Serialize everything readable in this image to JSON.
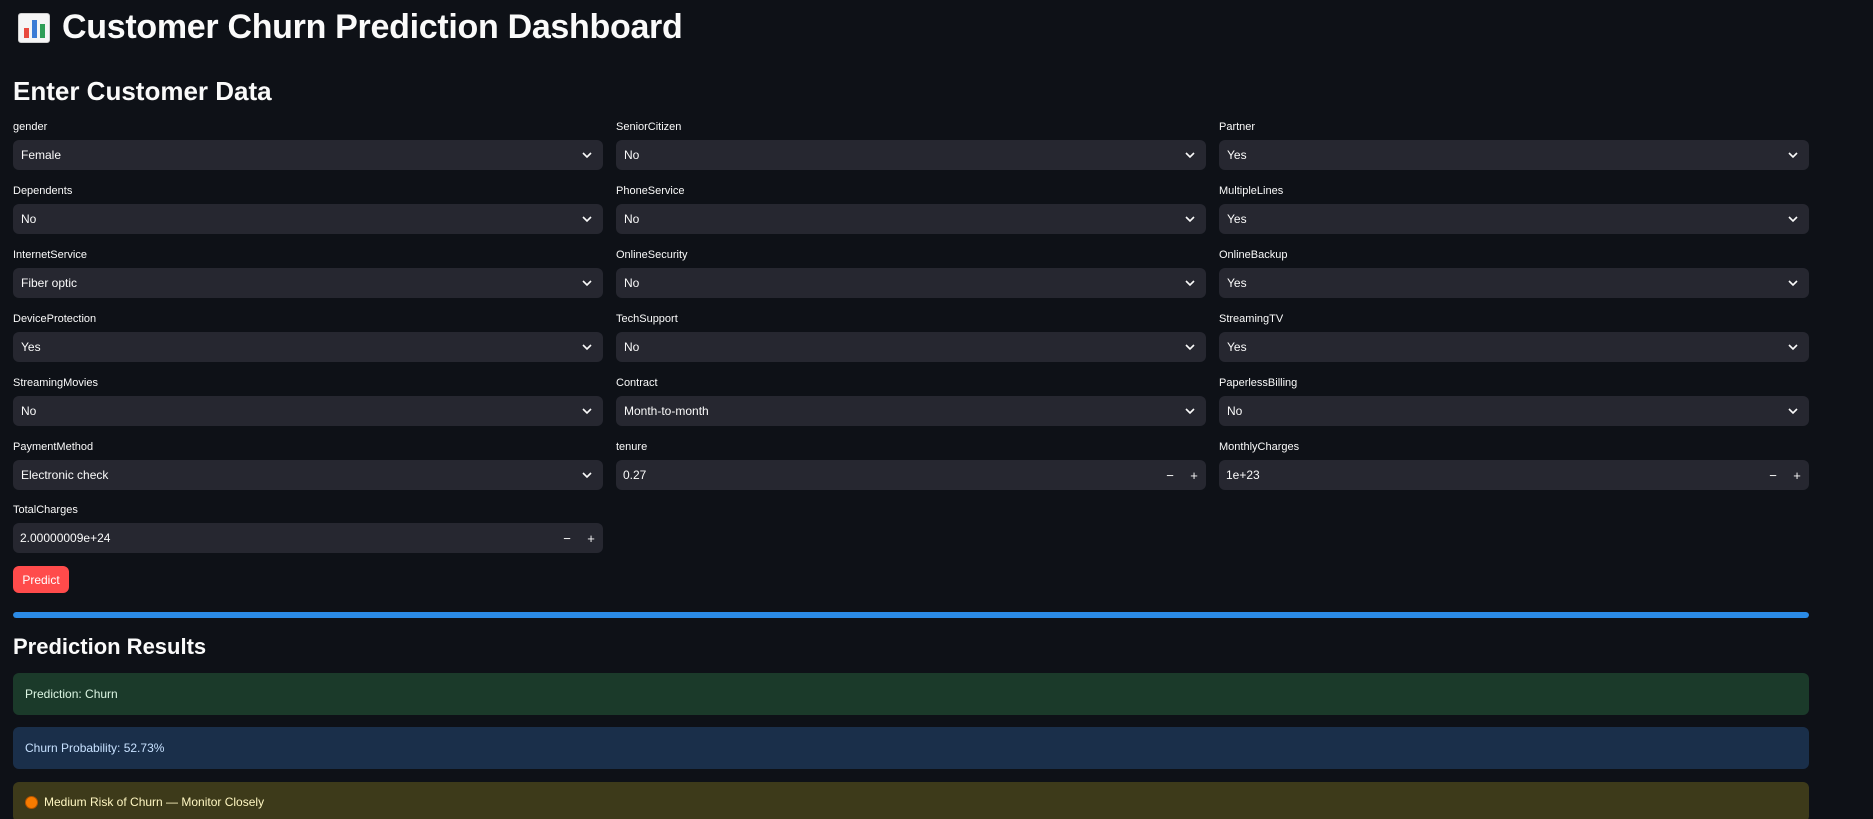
{
  "header": {
    "title": "Customer Churn Prediction Dashboard",
    "icon": "bar-chart-icon"
  },
  "form": {
    "section_title": "Enter Customer Data",
    "fields": [
      {
        "label": "gender",
        "value": "Female"
      },
      {
        "label": "SeniorCitizen",
        "value": "No"
      },
      {
        "label": "Partner",
        "value": "Yes"
      },
      {
        "label": "Dependents",
        "value": "No"
      },
      {
        "label": "PhoneService",
        "value": "No"
      },
      {
        "label": "MultipleLines",
        "value": "Yes"
      },
      {
        "label": "InternetService",
        "value": "Fiber optic"
      },
      {
        "label": "OnlineSecurity",
        "value": "No"
      },
      {
        "label": "OnlineBackup",
        "value": "Yes"
      },
      {
        "label": "DeviceProtection",
        "value": "Yes"
      },
      {
        "label": "TechSupport",
        "value": "No"
      },
      {
        "label": "StreamingTV",
        "value": "Yes"
      },
      {
        "label": "StreamingMovies",
        "value": "No"
      },
      {
        "label": "Contract",
        "value": "Month-to-month"
      },
      {
        "label": "PaperlessBilling",
        "value": "No"
      },
      {
        "label": "PaymentMethod",
        "value": "Electronic check"
      },
      {
        "label": "tenure",
        "value": "0.27"
      },
      {
        "label": "MonthlyCharges",
        "value": "1e+23"
      },
      {
        "label": "TotalCharges",
        "value": "2.00000009e+24"
      }
    ],
    "stepper_minus": "−",
    "stepper_plus": "+",
    "predict_label": "Predict"
  },
  "progress": {
    "fraction": 1.0,
    "color": "#2b8be6"
  },
  "results": {
    "section_title": "Prediction Results",
    "prediction_text": "Prediction: Churn",
    "probability_text": "Churn Probability: 52.73%",
    "risk_text": "Medium Risk of Churn — Monitor Closely",
    "risk_icon": "orange-circle-icon"
  },
  "colors": {
    "background": "#0e1117",
    "input_bg": "#262730",
    "button": "#ff4b4b",
    "success_bg": "#1b3a2a",
    "info_bg": "#1a2f4a",
    "warning_bg": "#3d3a1a"
  }
}
